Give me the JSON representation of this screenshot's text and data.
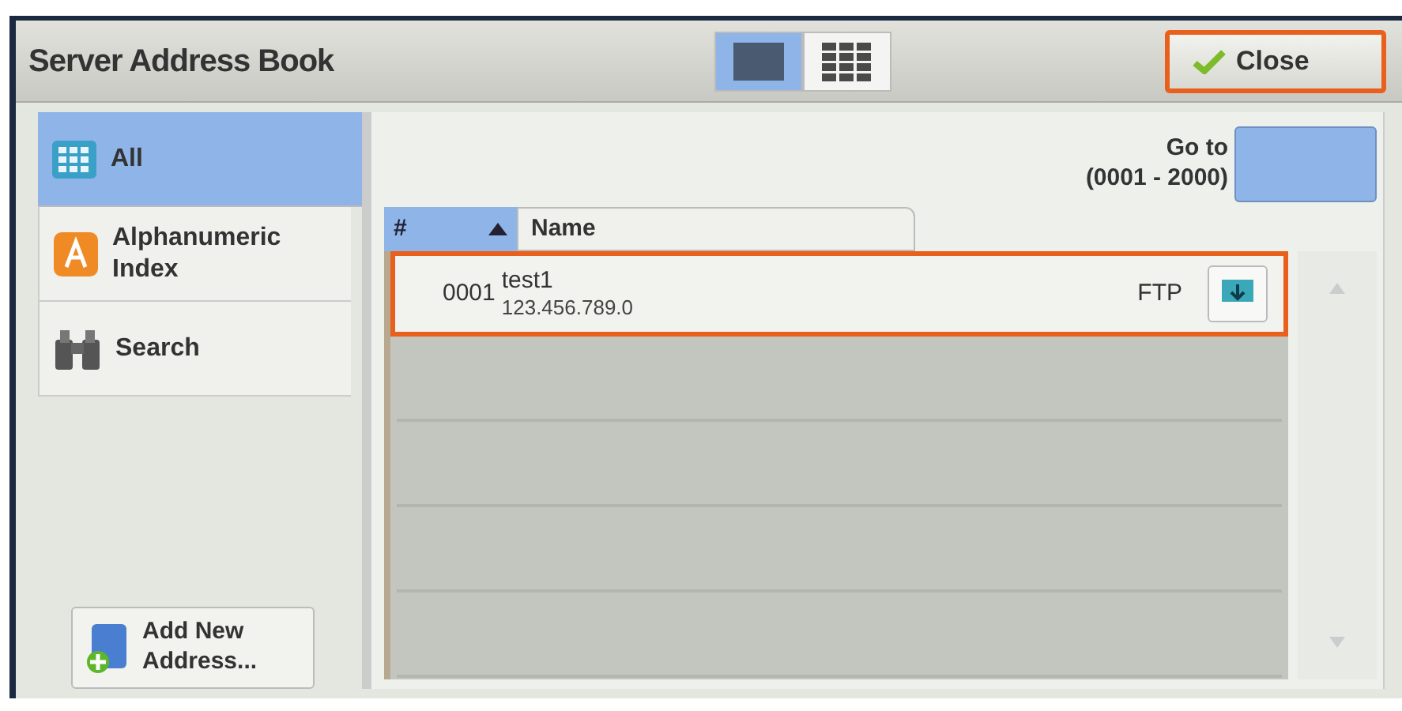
{
  "window": {
    "title": "Server Address Book"
  },
  "view_tabs": [
    {
      "kind": "list",
      "selected": true
    },
    {
      "kind": "grid",
      "selected": false
    }
  ],
  "close_button": {
    "label": "Close",
    "highlighted": true
  },
  "sidebar": {
    "items": [
      {
        "kind": "all",
        "label": "All",
        "selected": true
      },
      {
        "kind": "index",
        "label": "Alphanumeric Index",
        "selected": false
      },
      {
        "kind": "search",
        "label": "Search",
        "selected": false
      }
    ]
  },
  "add_button": {
    "lines": [
      "Add New",
      "Address..."
    ]
  },
  "goto": {
    "label": "Go to",
    "range": "(0001 - 2000)"
  },
  "table": {
    "columns": [
      "#",
      "Name"
    ],
    "rows": [
      {
        "number": "0001",
        "name": "test1",
        "address": "123.456.789.0",
        "protocol": "FTP",
        "highlighted": true
      }
    ]
  }
}
